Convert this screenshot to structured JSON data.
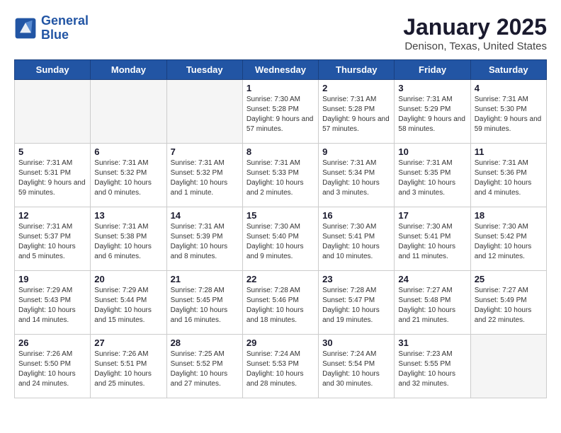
{
  "header": {
    "logo_line1": "General",
    "logo_line2": "Blue",
    "title": "January 2025",
    "subtitle": "Denison, Texas, United States"
  },
  "days_of_week": [
    "Sunday",
    "Monday",
    "Tuesday",
    "Wednesday",
    "Thursday",
    "Friday",
    "Saturday"
  ],
  "weeks": [
    [
      {
        "day": "",
        "info": ""
      },
      {
        "day": "",
        "info": ""
      },
      {
        "day": "",
        "info": ""
      },
      {
        "day": "1",
        "info": "Sunrise: 7:30 AM\nSunset: 5:28 PM\nDaylight: 9 hours and 57 minutes."
      },
      {
        "day": "2",
        "info": "Sunrise: 7:31 AM\nSunset: 5:28 PM\nDaylight: 9 hours and 57 minutes."
      },
      {
        "day": "3",
        "info": "Sunrise: 7:31 AM\nSunset: 5:29 PM\nDaylight: 9 hours and 58 minutes."
      },
      {
        "day": "4",
        "info": "Sunrise: 7:31 AM\nSunset: 5:30 PM\nDaylight: 9 hours and 59 minutes."
      }
    ],
    [
      {
        "day": "5",
        "info": "Sunrise: 7:31 AM\nSunset: 5:31 PM\nDaylight: 9 hours and 59 minutes."
      },
      {
        "day": "6",
        "info": "Sunrise: 7:31 AM\nSunset: 5:32 PM\nDaylight: 10 hours and 0 minutes."
      },
      {
        "day": "7",
        "info": "Sunrise: 7:31 AM\nSunset: 5:32 PM\nDaylight: 10 hours and 1 minute."
      },
      {
        "day": "8",
        "info": "Sunrise: 7:31 AM\nSunset: 5:33 PM\nDaylight: 10 hours and 2 minutes."
      },
      {
        "day": "9",
        "info": "Sunrise: 7:31 AM\nSunset: 5:34 PM\nDaylight: 10 hours and 3 minutes."
      },
      {
        "day": "10",
        "info": "Sunrise: 7:31 AM\nSunset: 5:35 PM\nDaylight: 10 hours and 3 minutes."
      },
      {
        "day": "11",
        "info": "Sunrise: 7:31 AM\nSunset: 5:36 PM\nDaylight: 10 hours and 4 minutes."
      }
    ],
    [
      {
        "day": "12",
        "info": "Sunrise: 7:31 AM\nSunset: 5:37 PM\nDaylight: 10 hours and 5 minutes."
      },
      {
        "day": "13",
        "info": "Sunrise: 7:31 AM\nSunset: 5:38 PM\nDaylight: 10 hours and 6 minutes."
      },
      {
        "day": "14",
        "info": "Sunrise: 7:31 AM\nSunset: 5:39 PM\nDaylight: 10 hours and 8 minutes."
      },
      {
        "day": "15",
        "info": "Sunrise: 7:30 AM\nSunset: 5:40 PM\nDaylight: 10 hours and 9 minutes."
      },
      {
        "day": "16",
        "info": "Sunrise: 7:30 AM\nSunset: 5:41 PM\nDaylight: 10 hours and 10 minutes."
      },
      {
        "day": "17",
        "info": "Sunrise: 7:30 AM\nSunset: 5:41 PM\nDaylight: 10 hours and 11 minutes."
      },
      {
        "day": "18",
        "info": "Sunrise: 7:30 AM\nSunset: 5:42 PM\nDaylight: 10 hours and 12 minutes."
      }
    ],
    [
      {
        "day": "19",
        "info": "Sunrise: 7:29 AM\nSunset: 5:43 PM\nDaylight: 10 hours and 14 minutes."
      },
      {
        "day": "20",
        "info": "Sunrise: 7:29 AM\nSunset: 5:44 PM\nDaylight: 10 hours and 15 minutes."
      },
      {
        "day": "21",
        "info": "Sunrise: 7:28 AM\nSunset: 5:45 PM\nDaylight: 10 hours and 16 minutes."
      },
      {
        "day": "22",
        "info": "Sunrise: 7:28 AM\nSunset: 5:46 PM\nDaylight: 10 hours and 18 minutes."
      },
      {
        "day": "23",
        "info": "Sunrise: 7:28 AM\nSunset: 5:47 PM\nDaylight: 10 hours and 19 minutes."
      },
      {
        "day": "24",
        "info": "Sunrise: 7:27 AM\nSunset: 5:48 PM\nDaylight: 10 hours and 21 minutes."
      },
      {
        "day": "25",
        "info": "Sunrise: 7:27 AM\nSunset: 5:49 PM\nDaylight: 10 hours and 22 minutes."
      }
    ],
    [
      {
        "day": "26",
        "info": "Sunrise: 7:26 AM\nSunset: 5:50 PM\nDaylight: 10 hours and 24 minutes."
      },
      {
        "day": "27",
        "info": "Sunrise: 7:26 AM\nSunset: 5:51 PM\nDaylight: 10 hours and 25 minutes."
      },
      {
        "day": "28",
        "info": "Sunrise: 7:25 AM\nSunset: 5:52 PM\nDaylight: 10 hours and 27 minutes."
      },
      {
        "day": "29",
        "info": "Sunrise: 7:24 AM\nSunset: 5:53 PM\nDaylight: 10 hours and 28 minutes."
      },
      {
        "day": "30",
        "info": "Sunrise: 7:24 AM\nSunset: 5:54 PM\nDaylight: 10 hours and 30 minutes."
      },
      {
        "day": "31",
        "info": "Sunrise: 7:23 AM\nSunset: 5:55 PM\nDaylight: 10 hours and 32 minutes."
      },
      {
        "day": "",
        "info": ""
      }
    ]
  ]
}
